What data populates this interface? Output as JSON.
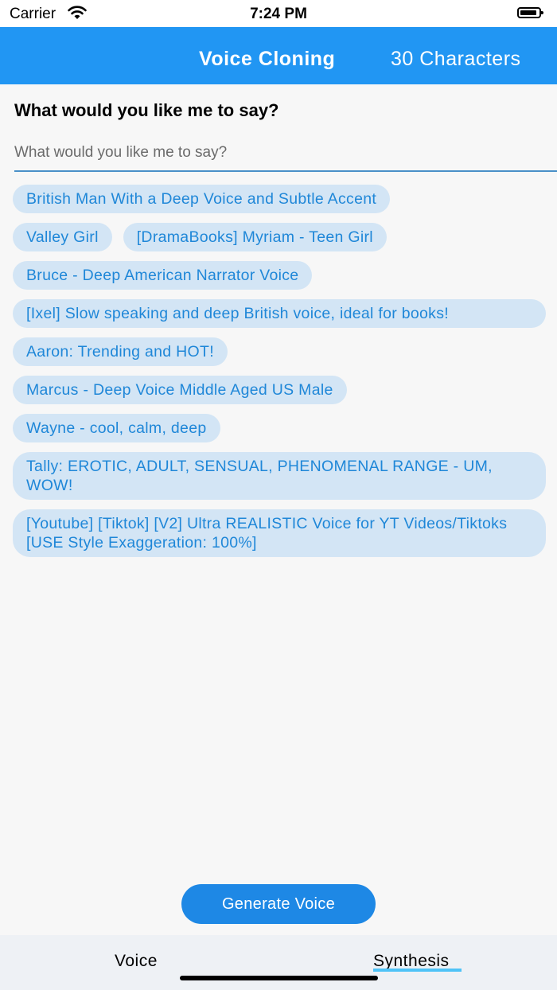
{
  "status_bar": {
    "carrier": "Carrier",
    "time": "7:24 PM"
  },
  "header": {
    "title": "Voice Cloning",
    "char_count": "30 Characters"
  },
  "prompt": {
    "title": "What would you like me to say?",
    "placeholder": "What would you like me to say?",
    "value": ""
  },
  "voices": [
    "British Man With a Deep Voice and Subtle Accent",
    "Valley Girl",
    "[DramaBooks] Myriam - Teen Girl",
    "Bruce - Deep American Narrator Voice",
    "[Ixel] Slow speaking and deep British voice, ideal for books!",
    "Aaron:  Trending and HOT!",
    "Marcus - Deep Voice Middle Aged US Male",
    "Wayne - cool, calm, deep",
    "Tally:  EROTIC, ADULT, SENSUAL, PHENOMENAL RANGE - UM, WOW!",
    "[Youtube] [Tiktok] [V2] Ultra REALISTIC Voice for YT Videos/Tiktoks [USE Style Exaggeration: 100%]"
  ],
  "generate_button": "Generate Voice",
  "tabs": [
    {
      "label": "Voice",
      "active": false
    },
    {
      "label": "Synthesis",
      "active": true
    }
  ],
  "colors": {
    "app_bar": "#2196f3",
    "chip_bg": "#d3e5f5",
    "chip_text": "#1f87d8",
    "button": "#1e88e5",
    "tab_indicator": "#4fc3f7"
  }
}
